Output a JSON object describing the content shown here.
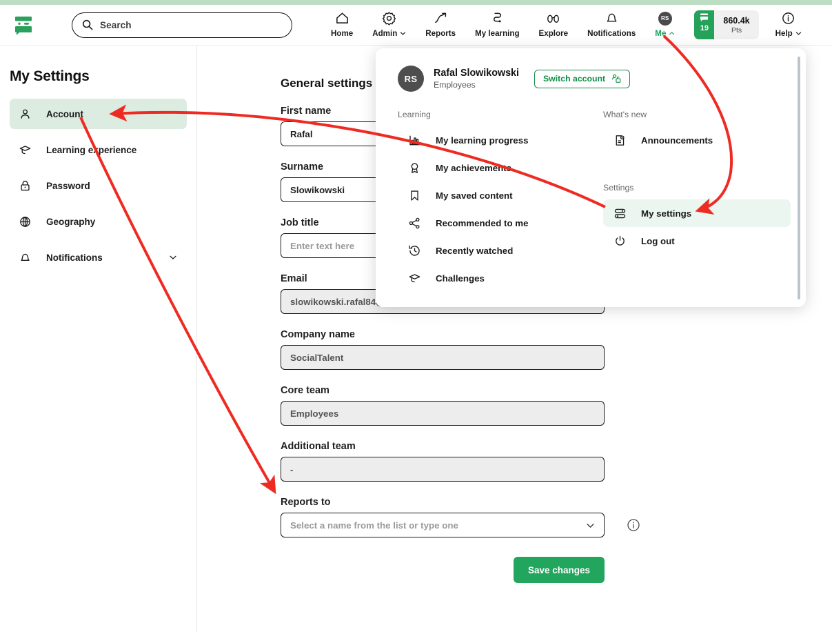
{
  "header": {
    "logo_icon": "socialtalent-logo-icon",
    "search": {
      "placeholder": "Search",
      "value": "",
      "icon": "search-icon"
    },
    "nav": [
      {
        "label": "Home",
        "icon": "home-icon",
        "has_caret": false,
        "active": false
      },
      {
        "label": "Admin",
        "icon": "gear-icon",
        "has_caret": true,
        "active": false
      },
      {
        "label": "Reports",
        "icon": "trending-up-icon",
        "has_caret": false,
        "active": false
      },
      {
        "label": "My learning",
        "icon": "path-icon",
        "has_caret": false,
        "active": false
      },
      {
        "label": "Explore",
        "icon": "binoculars-icon",
        "has_caret": false,
        "active": false
      },
      {
        "label": "Notifications",
        "icon": "bell-icon",
        "has_caret": false,
        "active": false
      },
      {
        "label": "Me",
        "icon": "avatar-icon",
        "has_caret": true,
        "active": true,
        "initials": "RS"
      },
      {
        "label": "Help",
        "icon": "info-icon",
        "has_caret": true,
        "active": false
      }
    ],
    "points": {
      "level": "19",
      "value": "860.4k",
      "unit": "Pts",
      "icon": "points-badge-icon"
    }
  },
  "sidebar": {
    "title": "My Settings",
    "items": [
      {
        "label": "Account",
        "icon": "person-icon",
        "active": true,
        "expandable": false
      },
      {
        "label": "Learning experience",
        "icon": "graduation-cap-icon",
        "active": false,
        "expandable": false
      },
      {
        "label": "Password",
        "icon": "lock-icon",
        "active": false,
        "expandable": false
      },
      {
        "label": "Geography",
        "icon": "globe-icon",
        "active": false,
        "expandable": false
      },
      {
        "label": "Notifications",
        "icon": "bell-icon",
        "active": false,
        "expandable": true
      }
    ]
  },
  "main": {
    "title": "General settings",
    "fields": [
      {
        "label": "First name",
        "value": "Rafal",
        "placeholder": "",
        "state": "editable",
        "type": "text"
      },
      {
        "label": "Surname",
        "value": "Slowikowski",
        "placeholder": "",
        "state": "editable",
        "type": "text"
      },
      {
        "label": "Job title",
        "value": "",
        "placeholder": "Enter text here",
        "state": "editable",
        "type": "text"
      },
      {
        "label": "Email",
        "value": "slowikowski.rafal84@gmail.com",
        "placeholder": "",
        "state": "readonly",
        "type": "text"
      },
      {
        "label": "Company name",
        "value": "SocialTalent",
        "placeholder": "",
        "state": "readonly",
        "type": "text"
      },
      {
        "label": "Core team",
        "value": "Employees",
        "placeholder": "",
        "state": "readonly",
        "type": "text"
      },
      {
        "label": "Additional team",
        "value": "-",
        "placeholder": "",
        "state": "readonly",
        "type": "text"
      },
      {
        "label": "Reports to",
        "value": "",
        "placeholder": "Select a name from the list or type one",
        "state": "editable",
        "type": "select",
        "info_icon": "info-icon"
      }
    ],
    "save_label": "Save changes"
  },
  "me_panel": {
    "avatar_initials": "RS",
    "user_name": "Rafal Slowikowski",
    "user_role": "Employees",
    "switch_account_label": "Switch account",
    "switch_account_icon": "switch-account-icon",
    "sections": [
      {
        "title": "Learning",
        "items": [
          {
            "label": "My learning progress",
            "icon": "bar-chart-icon",
            "active": false
          },
          {
            "label": "My achievements",
            "icon": "award-icon",
            "active": false
          },
          {
            "label": "My saved content",
            "icon": "bookmark-icon",
            "active": false
          },
          {
            "label": "Recommended to me",
            "icon": "share-icon",
            "active": false
          },
          {
            "label": "Recently watched",
            "icon": "history-icon",
            "active": false
          },
          {
            "label": "Challenges",
            "icon": "graduation-cap-icon",
            "active": false
          }
        ]
      },
      {
        "title": "What's new",
        "items": [
          {
            "label": "Announcements",
            "icon": "announcement-icon",
            "active": false
          }
        ]
      },
      {
        "title": "Settings",
        "items": [
          {
            "label": "My settings",
            "icon": "sliders-icon",
            "active": true
          },
          {
            "label": "Log out",
            "icon": "power-icon",
            "active": false
          }
        ]
      }
    ]
  },
  "annotations": {
    "color": "#ee2b22",
    "arrows": [
      {
        "name": "arrow-me-to-my-settings",
        "from": "Me",
        "to": "My settings"
      },
      {
        "name": "arrow-my-settings-to-account",
        "from": "My settings",
        "to": "Account"
      },
      {
        "name": "arrow-account-to-reports-to",
        "from": "Account",
        "to": "Reports to"
      }
    ]
  },
  "colors": {
    "brand_green": "#22a55d",
    "accent_green_text": "#17a05a",
    "top_strip": "#bedec4",
    "sidebar_active_bg": "#dcece1",
    "panel_active_bg": "#eaf6ef",
    "readonly_bg": "#ededed",
    "annotation_red": "#ee2b22"
  }
}
